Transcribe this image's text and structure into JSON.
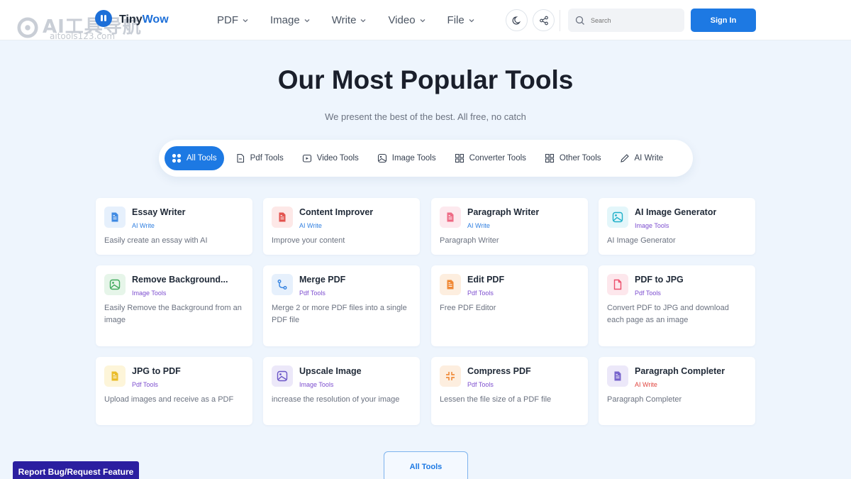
{
  "watermark": {
    "text": "AI工具导航",
    "sub": "aitools123.com"
  },
  "brand": {
    "part1": "Tiny",
    "part2": "Wow"
  },
  "nav": [
    "PDF",
    "Image",
    "Write",
    "Video",
    "File"
  ],
  "search": {
    "placeholder": "Search"
  },
  "signin_label": "Sign In",
  "hero": {
    "title": "Our Most Popular Tools",
    "subtitle": "We present the best of the best. All free, no catch"
  },
  "tabs": [
    "All Tools",
    "Pdf Tools",
    "Video Tools",
    "Image Tools",
    "Converter Tools",
    "Other Tools",
    "AI Write"
  ],
  "cards": [
    {
      "title": "Essay Writer",
      "category": "AI Write",
      "desc": "Easily create an essay with AI",
      "icon": "document-icon",
      "color": "#2f7fe0",
      "bg": "#e6f0fc",
      "catColor": "#2f7fe0"
    },
    {
      "title": "Content Improver",
      "category": "AI Write",
      "desc": "Improve your content",
      "icon": "document-icon",
      "color": "#e0453f",
      "bg": "#fde8e7",
      "catColor": "#2f7fe0"
    },
    {
      "title": "Paragraph Writer",
      "category": "AI Write",
      "desc": "Paragraph Writer",
      "icon": "document-icon",
      "color": "#ec5d7a",
      "bg": "#fde9ee",
      "catColor": "#2f7fe0"
    },
    {
      "title": "AI Image Generator",
      "category": "Image Tools",
      "desc": "AI Image Generator",
      "icon": "image-icon",
      "color": "#1fb0c9",
      "bg": "#e3f6fa",
      "catColor": "#7c4dcf"
    },
    {
      "title": "Remove Background...",
      "category": "Image Tools",
      "desc": "Easily Remove the Background from an image",
      "icon": "image-icon",
      "color": "#3fa95b",
      "bg": "#e6f5e9",
      "catColor": "#7c4dcf"
    },
    {
      "title": "Merge PDF",
      "category": "Pdf Tools",
      "desc": "Merge 2 or more PDF files into a single PDF file",
      "icon": "merge-icon",
      "color": "#2f7fe0",
      "bg": "#e6f0fc",
      "catColor": "#7c4dcf"
    },
    {
      "title": "Edit PDF",
      "category": "Pdf Tools",
      "desc": "Free PDF Editor",
      "icon": "document-icon",
      "color": "#ee7d23",
      "bg": "#fdeedf",
      "catColor": "#7c4dcf"
    },
    {
      "title": "PDF to JPG",
      "category": "Pdf Tools",
      "desc": "Convert PDF to JPG and download each page as an image",
      "icon": "file-icon",
      "color": "#ec4f6c",
      "bg": "#fde7ec",
      "catColor": "#7c4dcf"
    },
    {
      "title": "JPG to PDF",
      "category": "Pdf Tools",
      "desc": "Upload images and receive as a PDF",
      "icon": "document-icon",
      "color": "#e8b716",
      "bg": "#fdf5d9",
      "catColor": "#7c4dcf"
    },
    {
      "title": "Upscale Image",
      "category": "Image Tools",
      "desc": "increase the resolution of your image",
      "icon": "image-icon",
      "color": "#6b56c7",
      "bg": "#ece8f9",
      "catColor": "#7c4dcf"
    },
    {
      "title": "Compress PDF",
      "category": "Pdf Tools",
      "desc": "Lessen the file size of a PDF file",
      "icon": "compress-icon",
      "color": "#ee7d23",
      "bg": "#fdeedf",
      "catColor": "#7c4dcf"
    },
    {
      "title": "Paragraph Completer",
      "category": "AI Write",
      "desc": "Paragraph Completer",
      "icon": "document-icon",
      "color": "#6b56c7",
      "bg": "#ece8f9",
      "catColor": "#e0453f"
    }
  ],
  "all_tools_button": "All Tools",
  "report_button": "Report Bug/Request Feature"
}
